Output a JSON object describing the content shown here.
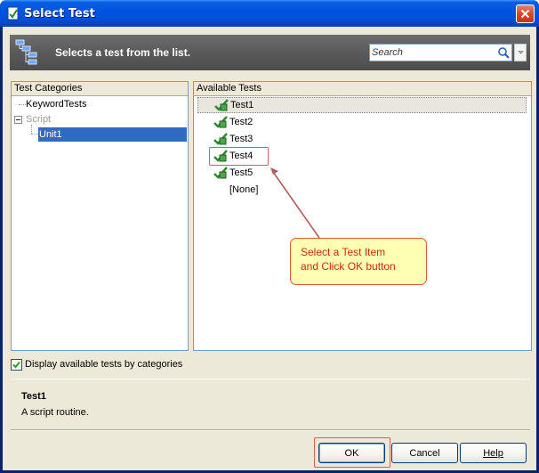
{
  "window": {
    "title": "Select Test"
  },
  "header": {
    "description": "Selects a test from the list.",
    "search_placeholder": "Search"
  },
  "categories": {
    "header": "Test Categories",
    "items": [
      {
        "label": "KeywordTests"
      },
      {
        "label": "Script"
      },
      {
        "label": "Unit1",
        "selected": true
      }
    ]
  },
  "tests": {
    "header": "Available Tests",
    "items": [
      {
        "label": "Test1",
        "selected": true
      },
      {
        "label": "Test2"
      },
      {
        "label": "Test3"
      },
      {
        "label": "Test4",
        "highlighted": true
      },
      {
        "label": "Test5"
      },
      {
        "label": "[None]"
      }
    ]
  },
  "callout": {
    "line1": "Select a Test Item",
    "line2": "and Click OK button"
  },
  "options": {
    "display_by_categories_label": "Display available tests by categories",
    "display_by_categories_checked": true
  },
  "description_panel": {
    "title": "Test1",
    "text": "A script routine."
  },
  "buttons": {
    "ok": "OK",
    "cancel": "Cancel",
    "help": "Help"
  },
  "colors": {
    "selection": "#316ac5",
    "callout_bg": "#ffffb4",
    "callout_text": "#cc2a0a",
    "highlight_border": "#d45f5f"
  }
}
